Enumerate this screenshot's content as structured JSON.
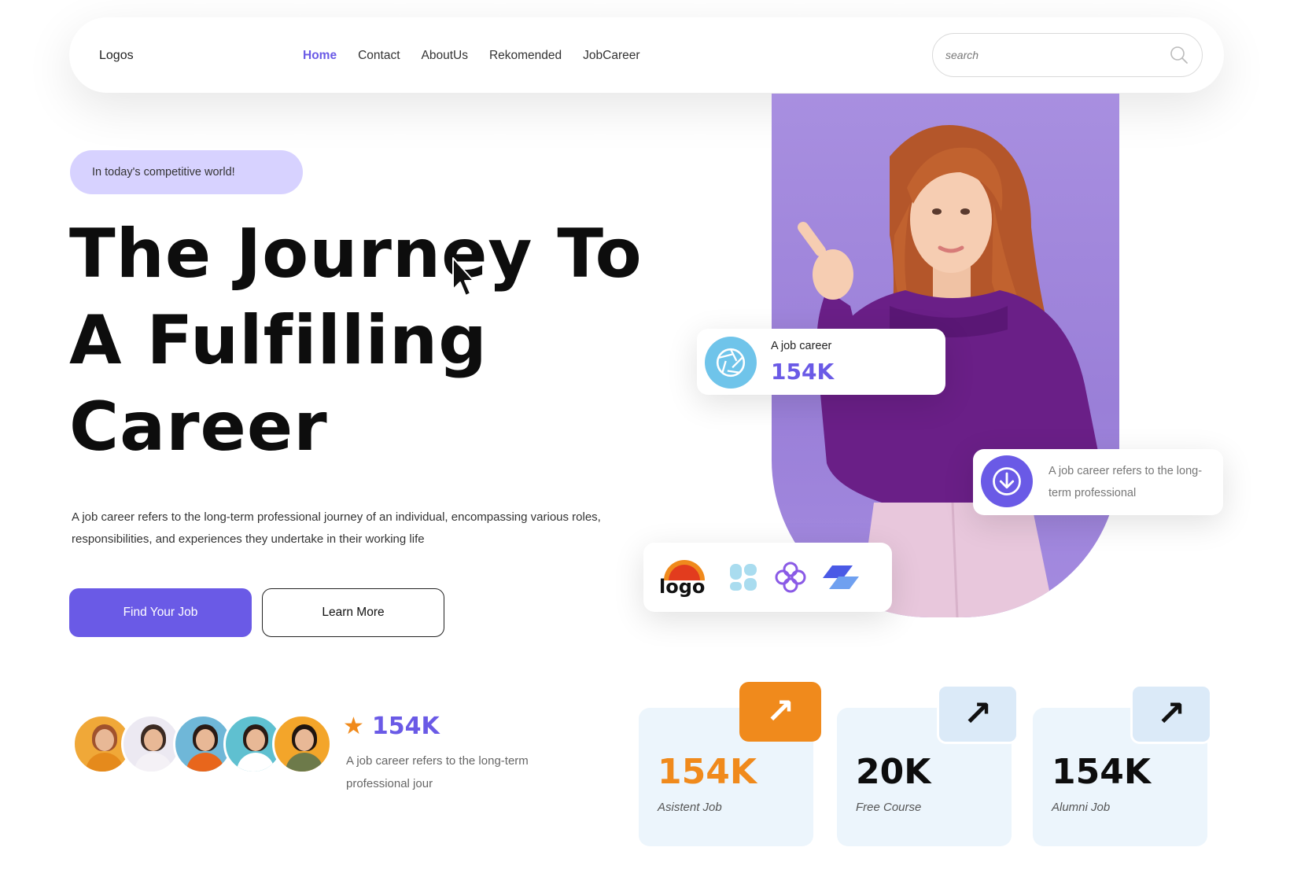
{
  "nav": {
    "logo": "Logos",
    "links": [
      "Home",
      "Contact",
      "AboutUs",
      "Rekomended",
      "JobCareer"
    ],
    "active": "Home",
    "search_placeholder": "search"
  },
  "hero": {
    "badge": "In today's competitive world!",
    "title_line1": "The Journey To",
    "title_line2": "A Fulfilling",
    "title_line3": "Career",
    "description": "A job career refers to the long-term professional journey of an individual, encompassing various roles, responsibilities, and experiences they undertake in their working life",
    "primary_button": "Find Your Job",
    "secondary_button": "Learn More"
  },
  "social_proof": {
    "rating_value": "154K",
    "rating_desc": "A job career refers to the long-term professional jour"
  },
  "floating": {
    "job_card_label": "A job career",
    "job_card_value": "154K",
    "info_card_text": "A job career refers to the long-term professional",
    "brand_logo_text": "logo"
  },
  "stats": [
    {
      "value": "154K",
      "label": "Asistent Job"
    },
    {
      "value": "20K",
      "label": "Free Course"
    },
    {
      "value": "154K",
      "label": "Alumni Job"
    }
  ],
  "colors": {
    "accent": "#6a5ae6",
    "orange": "#f08a1c",
    "badge_bg": "#d7d2ff",
    "stat_bg": "#ecf5fc",
    "photo_bg": "#a88fe0"
  }
}
